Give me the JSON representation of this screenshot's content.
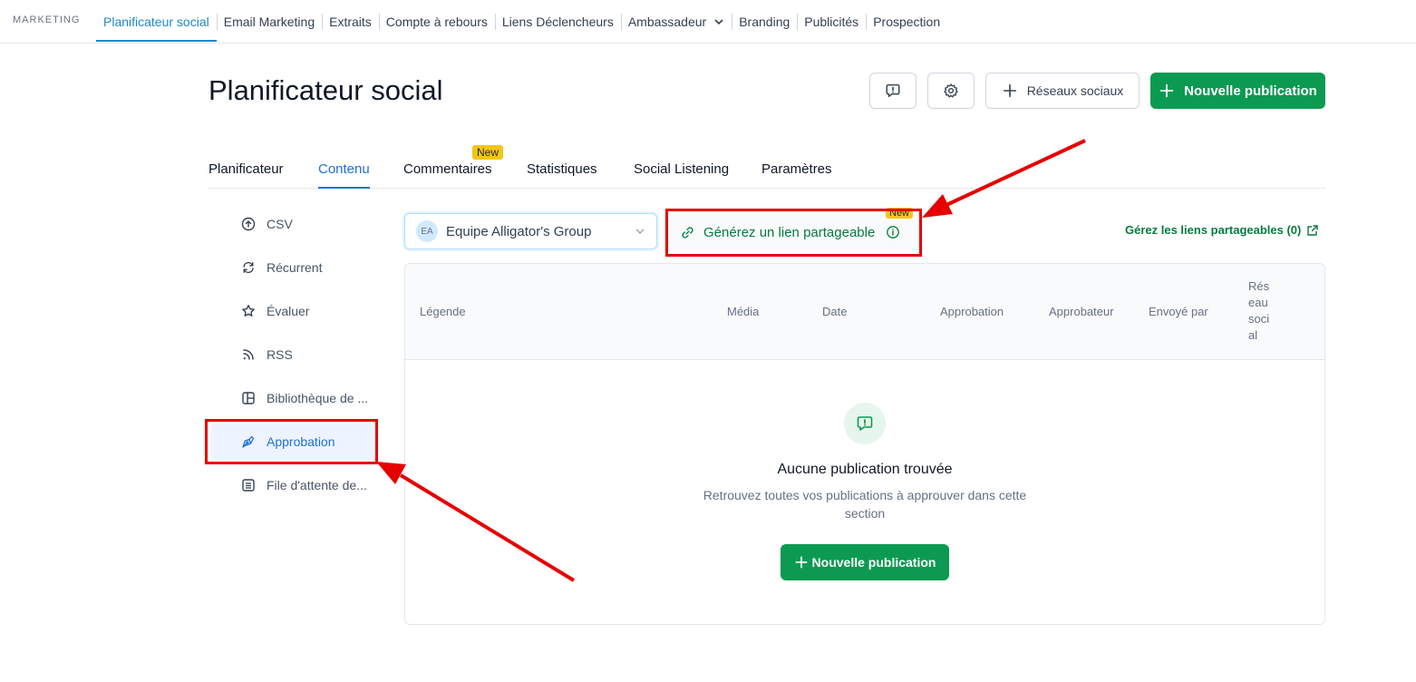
{
  "topnav": {
    "brand": "MARKETING",
    "items": [
      {
        "label": "Planificateur social"
      },
      {
        "label": "Email Marketing"
      },
      {
        "label": "Extraits"
      },
      {
        "label": "Compte à rebours"
      },
      {
        "label": "Liens Déclencheurs"
      },
      {
        "label": "Ambassadeur"
      },
      {
        "label": "Branding"
      },
      {
        "label": "Publicités"
      },
      {
        "label": "Prospection"
      }
    ]
  },
  "header": {
    "title": "Planificateur social",
    "social_label": "Réseaux sociaux",
    "new_label": "Nouvelle publication"
  },
  "tabs": [
    {
      "label": "Planificateur"
    },
    {
      "label": "Contenu"
    },
    {
      "label": "Commentaires",
      "badge": "New"
    },
    {
      "label": "Statistiques"
    },
    {
      "label": "Social Listening"
    },
    {
      "label": "Paramètres"
    }
  ],
  "sidemenu": [
    {
      "label": "CSV",
      "icon": "upload-circle-icon"
    },
    {
      "label": "Récurrent",
      "icon": "recurring-icon"
    },
    {
      "label": "Évaluer",
      "icon": "star-icon"
    },
    {
      "label": "RSS",
      "icon": "rss-icon"
    },
    {
      "label": "Bibliothèque de ...",
      "icon": "library-icon"
    },
    {
      "label": "Approbation",
      "icon": "pen-tool-icon"
    },
    {
      "label": "File d'attente de...",
      "icon": "queue-list-icon"
    }
  ],
  "filters": {
    "team_initials": "EA",
    "team_value": "Equipe Alligator's Group",
    "share_label": "Générez un lien partageable",
    "share_badge": "New",
    "manage_label": "Gérez les liens partageables (0)"
  },
  "table": {
    "columns": [
      "Légende",
      "Média",
      "Date",
      "Approbation",
      "Approbateur",
      "Envoyé par",
      "Réseau social"
    ]
  },
  "empty": {
    "title": "Aucune publication trouvée",
    "description": "Retrouvez toutes vos publications à approuver dans cette section",
    "button_label": "Nouvelle publication"
  },
  "colors": {
    "accent_blue": "#1e6fd9",
    "primary_green": "#0c9a52",
    "annotation_red": "#e60000"
  }
}
